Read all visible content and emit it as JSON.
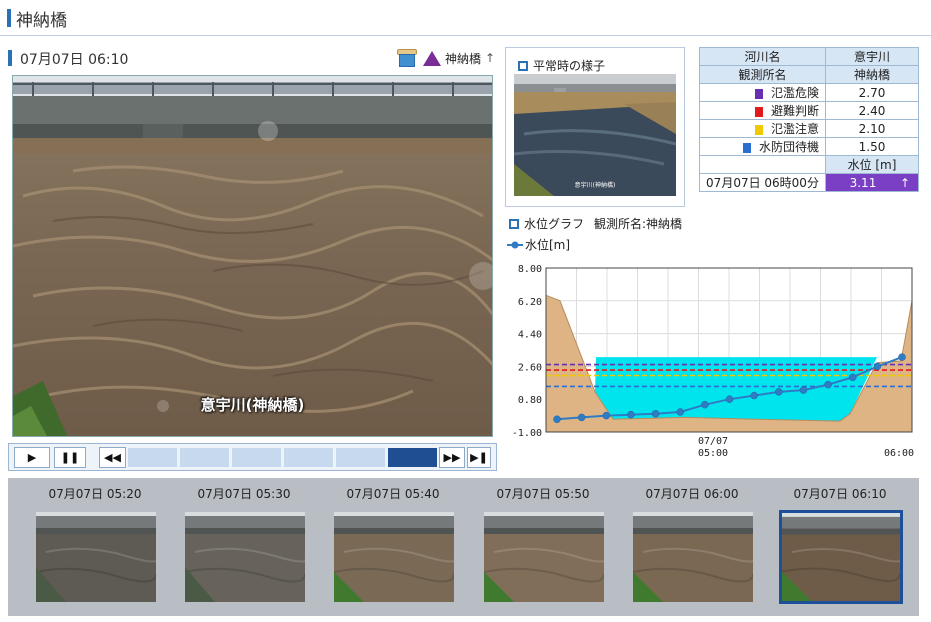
{
  "page": {
    "title": "神納橋"
  },
  "camera": {
    "timestamp": "07月07日 06:10",
    "station_link": "神納橋",
    "arrow": "↑",
    "caption": "意宇川(神納橋)"
  },
  "normal": {
    "label": "平常時の様子",
    "caption": "意宇川(神納橋)"
  },
  "table": {
    "river_label": "河川名",
    "river": "意宇川",
    "station_label": "観測所名",
    "station": "神納橋",
    "levels": [
      {
        "name": "氾濫危険",
        "value": "2.70",
        "color": "#6a2fb0"
      },
      {
        "name": "避難判断",
        "value": "2.40",
        "color": "#e01a1a"
      },
      {
        "name": "氾濫注意",
        "value": "2.10",
        "color": "#f2c800"
      },
      {
        "name": "水防団待機",
        "value": "1.50",
        "color": "#2a6fcf"
      }
    ],
    "wl_header": "水位 [m]",
    "current_time": "07月07日 06時00分",
    "current_value": "3.11",
    "current_arrow": "↑"
  },
  "graph": {
    "title": "水位グラフ",
    "station_text": "観測所名:神納橋",
    "legend": "水位[m]"
  },
  "chart_data": {
    "type": "line",
    "ylim": [
      -1.0,
      8.0
    ],
    "y_ticks": [
      "8.00",
      "6.20",
      "4.40",
      "2.60",
      "0.80",
      "-1.00"
    ],
    "x_tick_labels": [
      {
        "line1": "07/07",
        "line2": "05:00"
      },
      {
        "line1": "",
        "line2": "06:00"
      }
    ],
    "series": [
      {
        "name": "水位[m]",
        "x": [
          "04:50",
          "04:55",
          "05:00",
          "05:05",
          "05:10",
          "05:15",
          "05:20",
          "05:25",
          "05:30",
          "05:35",
          "05:40",
          "05:45",
          "05:50",
          "05:55",
          "06:00"
        ],
        "values": [
          -0.3,
          -0.2,
          -0.1,
          -0.05,
          0.0,
          0.1,
          0.5,
          0.8,
          1.0,
          1.2,
          1.3,
          1.6,
          2.0,
          2.6,
          3.11
        ]
      }
    ],
    "thresholds": [
      {
        "name": "氾濫危険",
        "value": 2.7,
        "color": "#6a2fb0"
      },
      {
        "name": "避難判断",
        "value": 2.4,
        "color": "#e01a1a"
      },
      {
        "name": "氾濫注意",
        "value": 2.1,
        "color": "#f2c800"
      },
      {
        "name": "水防団待機",
        "value": 1.5,
        "color": "#2a6fcf"
      }
    ],
    "grid": true
  },
  "thumbnails": [
    {
      "time": "07月07日 05:20"
    },
    {
      "time": "07月07日 05:30"
    },
    {
      "time": "07月07日 05:40"
    },
    {
      "time": "07月07日 05:50"
    },
    {
      "time": "07月07日 06:00"
    },
    {
      "time": "07月07日 06:10"
    }
  ],
  "controls": {
    "play_icon": "▶",
    "pause_icon": "❚❚",
    "rewind_icon": "◀◀",
    "forward_icon": "▶▶",
    "end_icon": "▶❚"
  },
  "colors": {
    "accent": "#2a72b8",
    "cross_section": "#deb485",
    "water": "#00e4ee",
    "line": "#2f7cc4"
  }
}
